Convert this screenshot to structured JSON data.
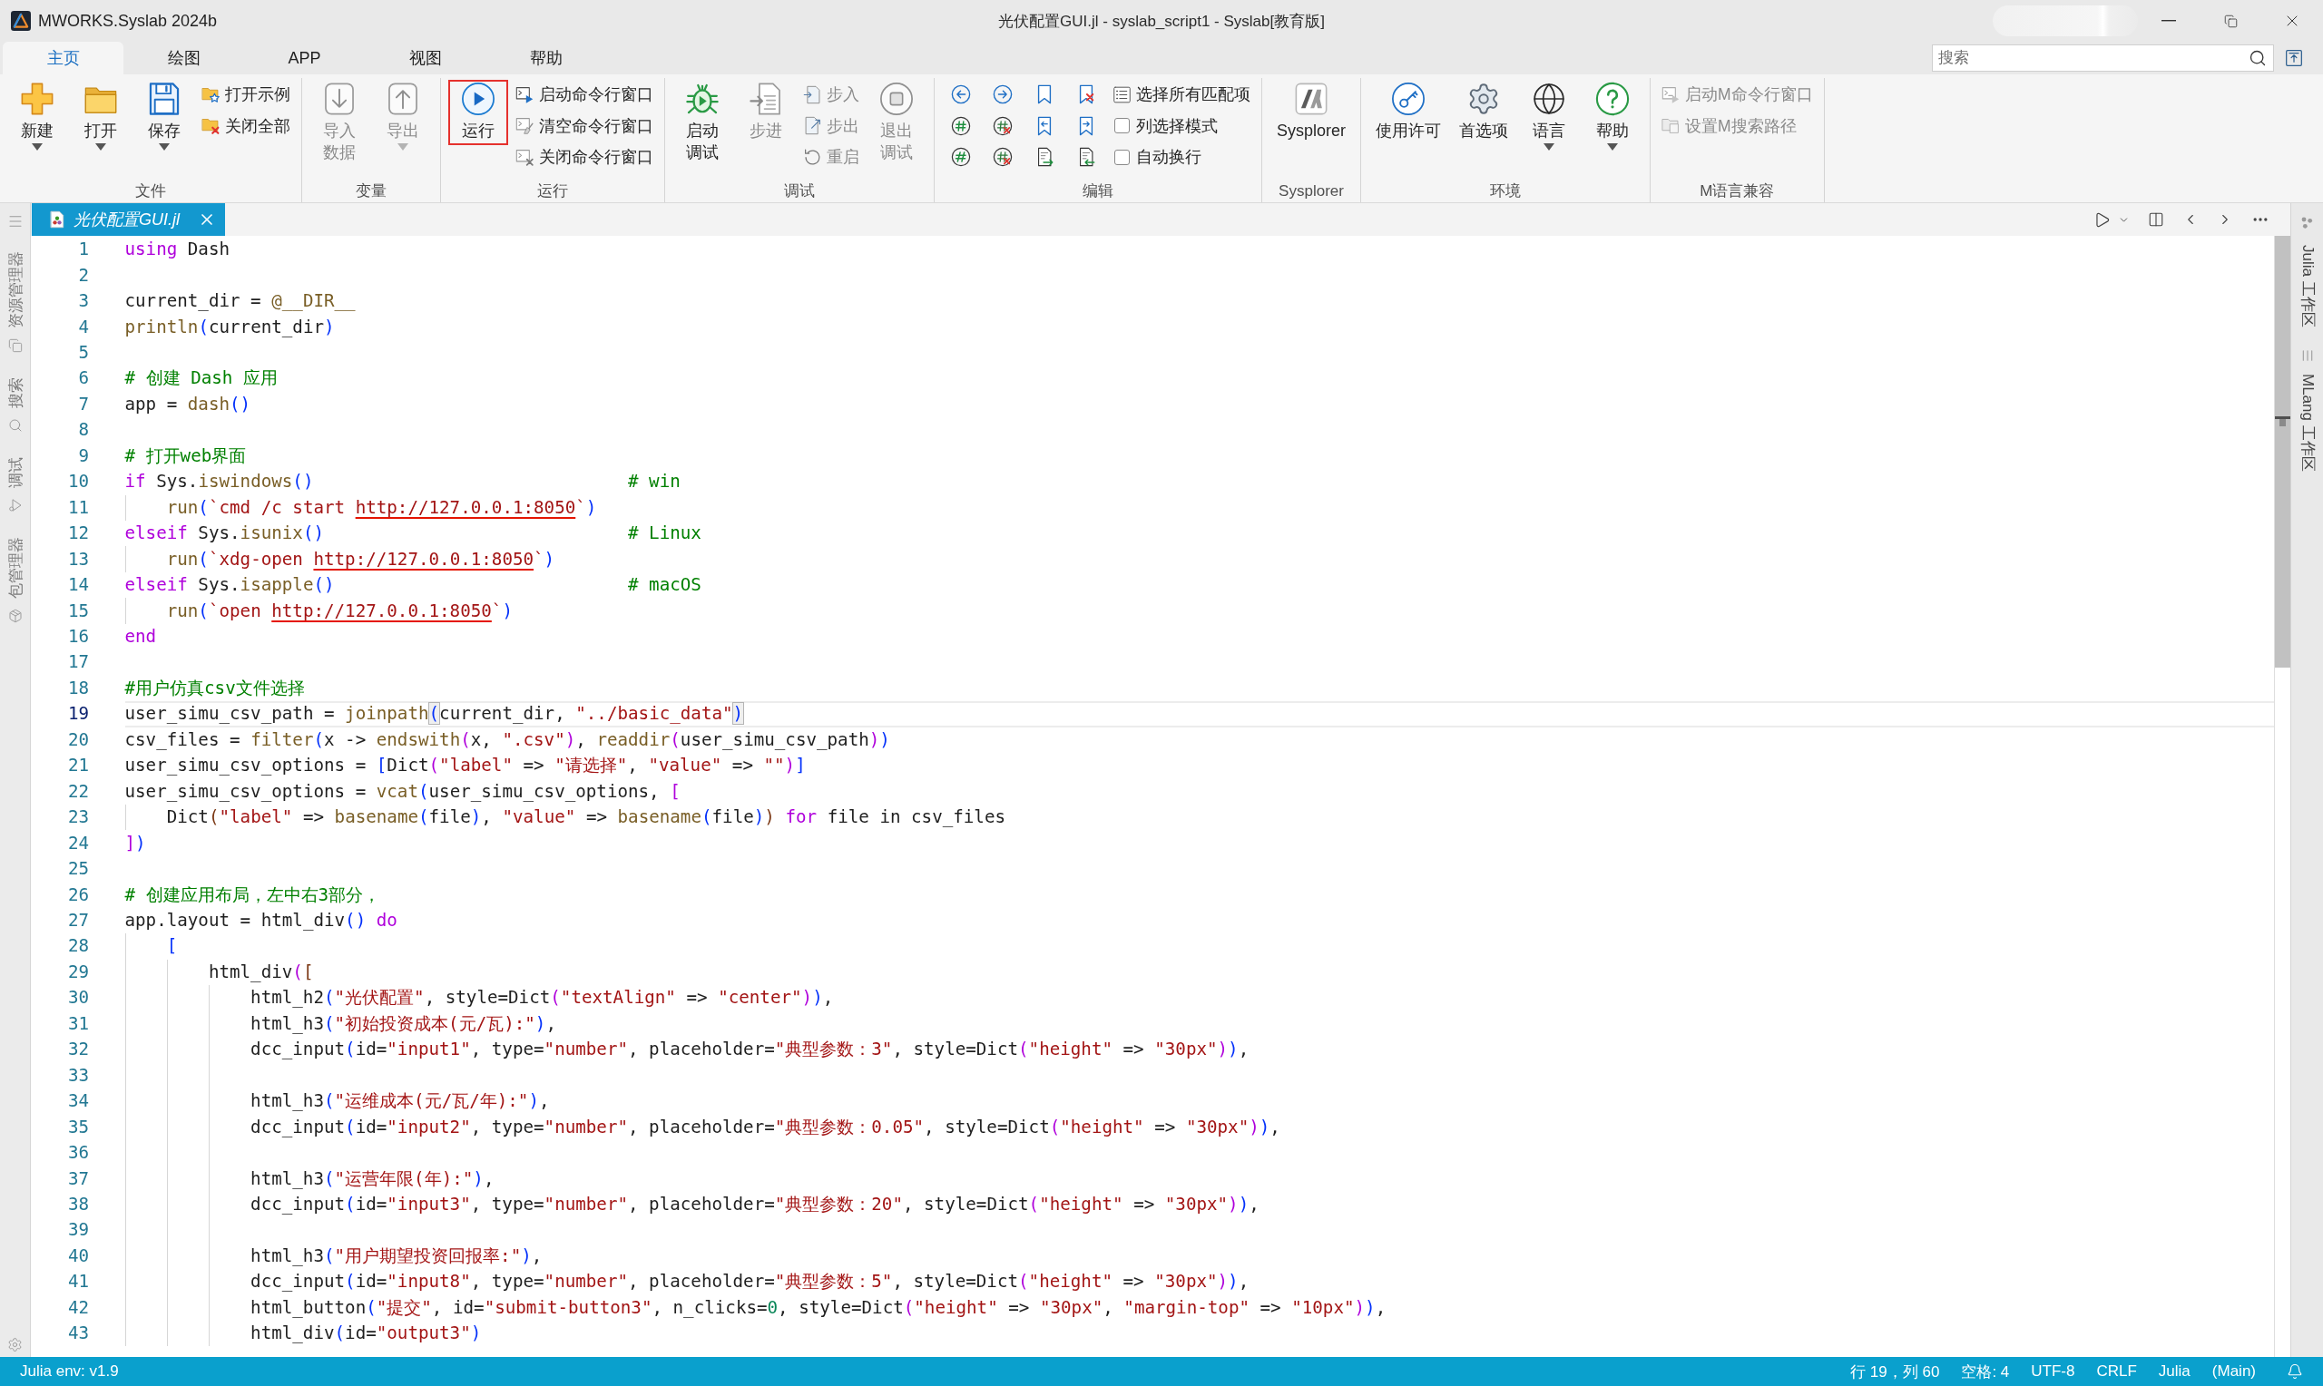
{
  "window": {
    "app_name": "MWORKS.Syslab 2024b",
    "title": "光伏配置GUI.jl - syslab_script1 - Syslab[教育版]"
  },
  "ribbon": {
    "tabs": [
      {
        "label": "主页",
        "selected": true
      },
      {
        "label": "绘图",
        "selected": false
      },
      {
        "label": "APP",
        "selected": false
      },
      {
        "label": "视图",
        "selected": false
      },
      {
        "label": "帮助",
        "selected": false
      }
    ],
    "search": {
      "placeholder": "搜索"
    },
    "groups": [
      {
        "label": "文件",
        "columns": [
          [
            {
              "kind": "large",
              "label_lines": [
                "新建"
              ],
              "dropdown": true,
              "disabled": false,
              "highlighted": false
            }
          ],
          [
            {
              "kind": "large",
              "label_lines": [
                "打开"
              ],
              "dropdown": true,
              "disabled": false,
              "highlighted": false
            }
          ],
          [
            {
              "kind": "large",
              "label_lines": [
                "保存"
              ],
              "dropdown": true,
              "disabled": false,
              "highlighted": false
            }
          ],
          [
            {
              "kind": "small",
              "label": "打开示例",
              "disabled": false
            },
            {
              "kind": "small",
              "label": "关闭全部",
              "disabled": false
            }
          ]
        ]
      },
      {
        "label": "变量",
        "columns": [
          [
            {
              "kind": "large",
              "label_lines": [
                "导入",
                "数据"
              ],
              "dropdown": false,
              "disabled": true,
              "highlighted": false
            }
          ],
          [
            {
              "kind": "large",
              "label_lines": [
                "导出"
              ],
              "dropdown": true,
              "disabled": true,
              "highlighted": false
            }
          ]
        ]
      },
      {
        "label": "运行",
        "columns": [
          [
            {
              "kind": "large",
              "label_lines": [
                "运行"
              ],
              "dropdown": false,
              "disabled": false,
              "highlighted": true
            }
          ],
          [
            {
              "kind": "small",
              "label": "启动命令行窗口",
              "disabled": false
            },
            {
              "kind": "small",
              "label": "清空命令行窗口",
              "disabled": false
            },
            {
              "kind": "small",
              "label": "关闭命令行窗口",
              "disabled": false
            }
          ]
        ]
      },
      {
        "label": "调试",
        "columns": [
          [
            {
              "kind": "large",
              "label_lines": [
                "启动",
                "调试"
              ],
              "dropdown": false,
              "disabled": false,
              "highlighted": false
            }
          ],
          [
            {
              "kind": "large",
              "label_lines": [
                "步进"
              ],
              "dropdown": false,
              "disabled": true,
              "highlighted": false
            }
          ],
          [
            {
              "kind": "small",
              "label": "步入",
              "disabled": true
            },
            {
              "kind": "small",
              "label": "步出",
              "disabled": true
            },
            {
              "kind": "small",
              "label": "重启",
              "disabled": true
            }
          ],
          [
            {
              "kind": "large",
              "label_lines": [
                "退出",
                "调试"
              ],
              "dropdown": false,
              "disabled": true,
              "highlighted": false
            }
          ]
        ]
      },
      {
        "label": "编辑",
        "columns": [
          [
            {
              "kind": "icon",
              "disabled": false
            },
            {
              "kind": "icon",
              "disabled": false
            },
            {
              "kind": "icon",
              "disabled": false
            }
          ],
          [
            {
              "kind": "icon",
              "disabled": false
            },
            {
              "kind": "icon",
              "disabled": false
            },
            {
              "kind": "icon",
              "disabled": false
            }
          ],
          [
            {
              "kind": "icon",
              "disabled": false
            },
            {
              "kind": "icon",
              "disabled": false
            },
            {
              "kind": "icon",
              "disabled": false
            }
          ],
          [
            {
              "kind": "icon",
              "disabled": false
            },
            {
              "kind": "icon",
              "disabled": false
            },
            {
              "kind": "icon",
              "disabled": false
            }
          ],
          [
            {
              "kind": "small",
              "label": "选择所有匹配项",
              "disabled": false
            },
            {
              "kind": "check",
              "label": "列选择模式",
              "checked": false
            },
            {
              "kind": "check",
              "label": "自动换行",
              "checked": false
            }
          ]
        ]
      },
      {
        "label": "Sysplorer",
        "columns": [
          [
            {
              "kind": "large",
              "label_lines": [
                "Sysplorer"
              ],
              "dropdown": false,
              "disabled": false,
              "highlighted": false
            }
          ]
        ]
      },
      {
        "label": "环境",
        "columns": [
          [
            {
              "kind": "large",
              "label_lines": [
                "使用许可"
              ],
              "dropdown": false,
              "disabled": false,
              "highlighted": false
            }
          ],
          [
            {
              "kind": "large",
              "label_lines": [
                "首选项"
              ],
              "dropdown": false,
              "disabled": false,
              "highlighted": false
            }
          ],
          [
            {
              "kind": "large",
              "label_lines": [
                "语言"
              ],
              "dropdown": true,
              "disabled": false,
              "highlighted": false
            }
          ],
          [
            {
              "kind": "large",
              "label_lines": [
                "帮助"
              ],
              "dropdown": true,
              "disabled": false,
              "highlighted": false
            }
          ]
        ]
      },
      {
        "label": "M语言兼容",
        "columns": [
          [
            {
              "kind": "small",
              "label": "启动M命令行窗口",
              "disabled": true
            },
            {
              "kind": "small",
              "label": "设置M搜索路径",
              "disabled": true
            }
          ]
        ]
      }
    ]
  },
  "activity_bar": [
    "资源管理器",
    "搜索",
    "调试",
    "包管理器"
  ],
  "editor": {
    "tabs": [
      {
        "label": "光伏配置GUI.jl",
        "selected": true
      }
    ],
    "lines": [
      {
        "number": "1",
        "current": false,
        "tokens": [
          {
            "text": "using",
            "kind": "keyword"
          },
          {
            "text": " Dash",
            "kind": "plain"
          }
        ]
      },
      {
        "number": "2",
        "current": false
      },
      {
        "number": "3",
        "current": false,
        "tokens": [
          {
            "text": "current_dir = ",
            "kind": "plain"
          },
          {
            "text": "@__DIR__",
            "kind": "macro"
          }
        ]
      },
      {
        "number": "4",
        "current": false,
        "tokens": [
          {
            "text": "println",
            "kind": "function"
          },
          {
            "text": "(",
            "kind": "bracket"
          },
          {
            "text": "current_dir",
            "kind": "plain"
          },
          {
            "text": ")",
            "kind": "bracket"
          }
        ]
      },
      {
        "number": "5",
        "current": false
      },
      {
        "number": "6",
        "current": false,
        "tokens": [
          {
            "text": "# 创建 Dash 应用",
            "kind": "comment"
          }
        ]
      },
      {
        "number": "7",
        "current": false,
        "tokens": [
          {
            "text": "app = ",
            "kind": "plain"
          },
          {
            "text": "dash",
            "kind": "function"
          },
          {
            "text": "()",
            "kind": "bracket"
          }
        ]
      },
      {
        "number": "8",
        "current": false
      },
      {
        "number": "9",
        "current": false,
        "tokens": [
          {
            "text": "# 打开web界面",
            "kind": "comment"
          }
        ]
      },
      {
        "number": "10",
        "current": false,
        "tokens": [
          {
            "text": "if",
            "kind": "keyword"
          },
          {
            "text": " Sys.",
            "kind": "plain"
          },
          {
            "text": "iswindows",
            "kind": "function"
          },
          {
            "text": "()",
            "kind": "bracket"
          },
          {
            "text": "                              # win",
            "kind": "comment"
          }
        ]
      },
      {
        "number": "11",
        "current": false,
        "tokens": [
          {
            "text": "    run",
            "kind": "function"
          },
          {
            "text": "(",
            "kind": "bracket"
          },
          {
            "text": "`cmd /c start ",
            "kind": "string"
          },
          {
            "text": "http://127.0.0.1:8050",
            "kind": "link"
          },
          {
            "text": "`",
            "kind": "string"
          },
          {
            "text": ")",
            "kind": "bracket"
          }
        ]
      },
      {
        "number": "12",
        "current": false,
        "tokens": [
          {
            "text": "elseif",
            "kind": "keyword"
          },
          {
            "text": " Sys.",
            "kind": "plain"
          },
          {
            "text": "isunix",
            "kind": "function"
          },
          {
            "text": "()",
            "kind": "bracket"
          },
          {
            "text": "                             # Linux",
            "kind": "comment"
          }
        ]
      },
      {
        "number": "13",
        "current": false,
        "tokens": [
          {
            "text": "    run",
            "kind": "function"
          },
          {
            "text": "(",
            "kind": "bracket"
          },
          {
            "text": "`xdg-open ",
            "kind": "string"
          },
          {
            "text": "http://127.0.0.1:8050",
            "kind": "link"
          },
          {
            "text": "`",
            "kind": "string"
          },
          {
            "text": ")",
            "kind": "bracket"
          }
        ]
      },
      {
        "number": "14",
        "current": false,
        "tokens": [
          {
            "text": "elseif",
            "kind": "keyword"
          },
          {
            "text": " Sys.",
            "kind": "plain"
          },
          {
            "text": "isapple",
            "kind": "function"
          },
          {
            "text": "()",
            "kind": "bracket"
          },
          {
            "text": "                            # macOS",
            "kind": "comment"
          }
        ]
      },
      {
        "number": "15",
        "current": false,
        "tokens": [
          {
            "text": "    run",
            "kind": "function"
          },
          {
            "text": "(",
            "kind": "bracket"
          },
          {
            "text": "`open ",
            "kind": "string"
          },
          {
            "text": "http://127.0.0.1:8050",
            "kind": "link"
          },
          {
            "text": "`",
            "kind": "string"
          },
          {
            "text": ")",
            "kind": "bracket"
          }
        ]
      },
      {
        "number": "16",
        "current": false,
        "tokens": [
          {
            "text": "end",
            "kind": "keyword"
          }
        ]
      },
      {
        "number": "17",
        "current": false
      },
      {
        "number": "18",
        "current": false,
        "tokens": [
          {
            "text": "#用户仿真csv文件选择",
            "kind": "comment"
          }
        ]
      },
      {
        "number": "19",
        "current": true,
        "tokens": [
          {
            "text": "user_simu_csv_path = ",
            "kind": "plain"
          },
          {
            "text": "joinpath",
            "kind": "function"
          },
          {
            "text": "(",
            "kind": "match"
          },
          {
            "text": "current_dir, ",
            "kind": "plain"
          },
          {
            "text": "\"../basic_data\"",
            "kind": "string"
          },
          {
            "text": ")",
            "kind": "match"
          }
        ]
      },
      {
        "number": "20",
        "current": false,
        "tokens": [
          {
            "text": "csv_files = ",
            "kind": "plain"
          },
          {
            "text": "filter",
            "kind": "function"
          },
          {
            "text": "(",
            "kind": "bracket"
          },
          {
            "text": "x -> ",
            "kind": "plain"
          },
          {
            "text": "endswith",
            "kind": "function"
          },
          {
            "text": "(",
            "kind": "bracket2"
          },
          {
            "text": "x, ",
            "kind": "plain"
          },
          {
            "text": "\".csv\"",
            "kind": "string"
          },
          {
            "text": ")",
            "kind": "bracket2"
          },
          {
            "text": ", ",
            "kind": "plain"
          },
          {
            "text": "readdir",
            "kind": "function"
          },
          {
            "text": "(",
            "kind": "bracket2"
          },
          {
            "text": "user_simu_csv_path",
            "kind": "plain"
          },
          {
            "text": ")",
            "kind": "bracket2"
          },
          {
            "text": ")",
            "kind": "bracket"
          }
        ]
      },
      {
        "number": "21",
        "current": false,
        "tokens": [
          {
            "text": "user_simu_csv_options = ",
            "kind": "plain"
          },
          {
            "text": "[",
            "kind": "bracket"
          },
          {
            "text": "Dict",
            "kind": "plain"
          },
          {
            "text": "(",
            "kind": "bracket2"
          },
          {
            "text": "\"label\"",
            "kind": "string"
          },
          {
            "text": " => ",
            "kind": "plain"
          },
          {
            "text": "\"请选择\"",
            "kind": "string"
          },
          {
            "text": ", ",
            "kind": "plain"
          },
          {
            "text": "\"value\"",
            "kind": "string"
          },
          {
            "text": " => ",
            "kind": "plain"
          },
          {
            "text": "\"\"",
            "kind": "string"
          },
          {
            "text": ")",
            "kind": "bracket2"
          },
          {
            "text": "]",
            "kind": "bracket"
          }
        ]
      },
      {
        "number": "22",
        "current": false,
        "tokens": [
          {
            "text": "user_simu_csv_options = ",
            "kind": "plain"
          },
          {
            "text": "vcat",
            "kind": "function"
          },
          {
            "text": "(",
            "kind": "bracket"
          },
          {
            "text": "user_simu_csv_options, ",
            "kind": "plain"
          },
          {
            "text": "[",
            "kind": "bracket2"
          }
        ]
      },
      {
        "number": "23",
        "current": false,
        "tokens": [
          {
            "text": "    Dict",
            "kind": "plain"
          },
          {
            "text": "(",
            "kind": "bracket3"
          },
          {
            "text": "\"label\"",
            "kind": "string"
          },
          {
            "text": " => ",
            "kind": "plain"
          },
          {
            "text": "basename",
            "kind": "function"
          },
          {
            "text": "(",
            "kind": "bracket"
          },
          {
            "text": "file",
            "kind": "plain"
          },
          {
            "text": ")",
            "kind": "bracket"
          },
          {
            "text": ", ",
            "kind": "plain"
          },
          {
            "text": "\"value\"",
            "kind": "string"
          },
          {
            "text": " => ",
            "kind": "plain"
          },
          {
            "text": "basename",
            "kind": "function"
          },
          {
            "text": "(",
            "kind": "bracket"
          },
          {
            "text": "file",
            "kind": "plain"
          },
          {
            "text": ")",
            "kind": "bracket"
          },
          {
            "text": ")",
            "kind": "bracket3"
          },
          {
            "text": " for",
            "kind": "keyword"
          },
          {
            "text": " file in csv_files",
            "kind": "plain"
          }
        ]
      },
      {
        "number": "24",
        "current": false,
        "tokens": [
          {
            "text": "]",
            "kind": "bracket2"
          },
          {
            "text": ")",
            "kind": "bracket"
          }
        ]
      },
      {
        "number": "25",
        "current": false
      },
      {
        "number": "26",
        "current": false,
        "tokens": [
          {
            "text": "# 创建应用布局，左中右3部分，",
            "kind": "comment"
          }
        ]
      },
      {
        "number": "27",
        "current": false,
        "tokens": [
          {
            "text": "app.layout = html_div",
            "kind": "plain"
          },
          {
            "text": "()",
            "kind": "bracket"
          },
          {
            "text": " do",
            "kind": "keyword"
          }
        ]
      },
      {
        "number": "28",
        "current": false,
        "tokens": [
          {
            "text": "    [",
            "kind": "bracket"
          }
        ]
      },
      {
        "number": "29",
        "current": false,
        "tokens": [
          {
            "text": "        html_div",
            "kind": "plain"
          },
          {
            "text": "(",
            "kind": "bracket2"
          },
          {
            "text": "[",
            "kind": "bracket3"
          }
        ]
      },
      {
        "number": "30",
        "current": false,
        "tokens": [
          {
            "text": "            html_h2",
            "kind": "plain"
          },
          {
            "text": "(",
            "kind": "bracket"
          },
          {
            "text": "\"光伏配置\"",
            "kind": "string"
          },
          {
            "text": ", style=Dict",
            "kind": "plain"
          },
          {
            "text": "(",
            "kind": "bracket2"
          },
          {
            "text": "\"textAlign\"",
            "kind": "string"
          },
          {
            "text": " => ",
            "kind": "plain"
          },
          {
            "text": "\"center\"",
            "kind": "string"
          },
          {
            "text": ")",
            "kind": "bracket2"
          },
          {
            "text": ")",
            "kind": "bracket"
          },
          {
            "text": ",",
            "kind": "plain"
          }
        ]
      },
      {
        "number": "31",
        "current": false,
        "tokens": [
          {
            "text": "            html_h3",
            "kind": "plain"
          },
          {
            "text": "(",
            "kind": "bracket"
          },
          {
            "text": "\"初始投资成本(元/瓦):\"",
            "kind": "string"
          },
          {
            "text": ")",
            "kind": "bracket"
          },
          {
            "text": ",",
            "kind": "plain"
          }
        ]
      },
      {
        "number": "32",
        "current": false,
        "tokens": [
          {
            "text": "            dcc_input",
            "kind": "plain"
          },
          {
            "text": "(",
            "kind": "bracket"
          },
          {
            "text": "id=",
            "kind": "plain"
          },
          {
            "text": "\"input1\"",
            "kind": "string"
          },
          {
            "text": ", type=",
            "kind": "plain"
          },
          {
            "text": "\"number\"",
            "kind": "string"
          },
          {
            "text": ", placeholder=",
            "kind": "plain"
          },
          {
            "text": "\"典型参数：3\"",
            "kind": "string"
          },
          {
            "text": ", style=Dict",
            "kind": "plain"
          },
          {
            "text": "(",
            "kind": "bracket2"
          },
          {
            "text": "\"height\"",
            "kind": "string"
          },
          {
            "text": " => ",
            "kind": "plain"
          },
          {
            "text": "\"30px\"",
            "kind": "string"
          },
          {
            "text": ")",
            "kind": "bracket2"
          },
          {
            "text": ")",
            "kind": "bracket"
          },
          {
            "text": ",",
            "kind": "plain"
          }
        ]
      },
      {
        "number": "33",
        "current": false
      },
      {
        "number": "34",
        "current": false,
        "tokens": [
          {
            "text": "            html_h3",
            "kind": "plain"
          },
          {
            "text": "(",
            "kind": "bracket"
          },
          {
            "text": "\"运维成本(元/瓦/年):\"",
            "kind": "string"
          },
          {
            "text": ")",
            "kind": "bracket"
          },
          {
            "text": ",",
            "kind": "plain"
          }
        ]
      },
      {
        "number": "35",
        "current": false,
        "tokens": [
          {
            "text": "            dcc_input",
            "kind": "plain"
          },
          {
            "text": "(",
            "kind": "bracket"
          },
          {
            "text": "id=",
            "kind": "plain"
          },
          {
            "text": "\"input2\"",
            "kind": "string"
          },
          {
            "text": ", type=",
            "kind": "plain"
          },
          {
            "text": "\"number\"",
            "kind": "string"
          },
          {
            "text": ", placeholder=",
            "kind": "plain"
          },
          {
            "text": "\"典型参数：0.05\"",
            "kind": "string"
          },
          {
            "text": ", style=Dict",
            "kind": "plain"
          },
          {
            "text": "(",
            "kind": "bracket2"
          },
          {
            "text": "\"height\"",
            "kind": "string"
          },
          {
            "text": " => ",
            "kind": "plain"
          },
          {
            "text": "\"30px\"",
            "kind": "string"
          },
          {
            "text": ")",
            "kind": "bracket2"
          },
          {
            "text": ")",
            "kind": "bracket"
          },
          {
            "text": ",",
            "kind": "plain"
          }
        ]
      },
      {
        "number": "36",
        "current": false
      },
      {
        "number": "37",
        "current": false,
        "tokens": [
          {
            "text": "            html_h3",
            "kind": "plain"
          },
          {
            "text": "(",
            "kind": "bracket"
          },
          {
            "text": "\"运营年限(年):\"",
            "kind": "string"
          },
          {
            "text": ")",
            "kind": "bracket"
          },
          {
            "text": ",",
            "kind": "plain"
          }
        ]
      },
      {
        "number": "38",
        "current": false,
        "tokens": [
          {
            "text": "            dcc_input",
            "kind": "plain"
          },
          {
            "text": "(",
            "kind": "bracket"
          },
          {
            "text": "id=",
            "kind": "plain"
          },
          {
            "text": "\"input3\"",
            "kind": "string"
          },
          {
            "text": ", type=",
            "kind": "plain"
          },
          {
            "text": "\"number\"",
            "kind": "string"
          },
          {
            "text": ", placeholder=",
            "kind": "plain"
          },
          {
            "text": "\"典型参数：20\"",
            "kind": "string"
          },
          {
            "text": ", style=Dict",
            "kind": "plain"
          },
          {
            "text": "(",
            "kind": "bracket2"
          },
          {
            "text": "\"height\"",
            "kind": "string"
          },
          {
            "text": " => ",
            "kind": "plain"
          },
          {
            "text": "\"30px\"",
            "kind": "string"
          },
          {
            "text": ")",
            "kind": "bracket2"
          },
          {
            "text": ")",
            "kind": "bracket"
          },
          {
            "text": ",",
            "kind": "plain"
          }
        ]
      },
      {
        "number": "39",
        "current": false
      },
      {
        "number": "40",
        "current": false,
        "tokens": [
          {
            "text": "            html_h3",
            "kind": "plain"
          },
          {
            "text": "(",
            "kind": "bracket"
          },
          {
            "text": "\"用户期望投资回报率:\"",
            "kind": "string"
          },
          {
            "text": ")",
            "kind": "bracket"
          },
          {
            "text": ",",
            "kind": "plain"
          }
        ]
      },
      {
        "number": "41",
        "current": false,
        "tokens": [
          {
            "text": "            dcc_input",
            "kind": "plain"
          },
          {
            "text": "(",
            "kind": "bracket"
          },
          {
            "text": "id=",
            "kind": "plain"
          },
          {
            "text": "\"input8\"",
            "kind": "string"
          },
          {
            "text": ", type=",
            "kind": "plain"
          },
          {
            "text": "\"number\"",
            "kind": "string"
          },
          {
            "text": ", placeholder=",
            "kind": "plain"
          },
          {
            "text": "\"典型参数：5\"",
            "kind": "string"
          },
          {
            "text": ", style=Dict",
            "kind": "plain"
          },
          {
            "text": "(",
            "kind": "bracket2"
          },
          {
            "text": "\"height\"",
            "kind": "string"
          },
          {
            "text": " => ",
            "kind": "plain"
          },
          {
            "text": "\"30px\"",
            "kind": "string"
          },
          {
            "text": ")",
            "kind": "bracket2"
          },
          {
            "text": ")",
            "kind": "bracket"
          },
          {
            "text": ",",
            "kind": "plain"
          }
        ]
      },
      {
        "number": "42",
        "current": false,
        "tokens": [
          {
            "text": "            html_button",
            "kind": "plain"
          },
          {
            "text": "(",
            "kind": "bracket"
          },
          {
            "text": "\"提交\"",
            "kind": "string"
          },
          {
            "text": ", id=",
            "kind": "plain"
          },
          {
            "text": "\"submit-button3\"",
            "kind": "string"
          },
          {
            "text": ", n_clicks=",
            "kind": "plain"
          },
          {
            "text": "0",
            "kind": "number"
          },
          {
            "text": ", style=Dict",
            "kind": "plain"
          },
          {
            "text": "(",
            "kind": "bracket2"
          },
          {
            "text": "\"height\"",
            "kind": "string"
          },
          {
            "text": " => ",
            "kind": "plain"
          },
          {
            "text": "\"30px\"",
            "kind": "string"
          },
          {
            "text": ", ",
            "kind": "plain"
          },
          {
            "text": "\"margin-top\"",
            "kind": "string"
          },
          {
            "text": " => ",
            "kind": "plain"
          },
          {
            "text": "\"10px\"",
            "kind": "string"
          },
          {
            "text": ")",
            "kind": "bracket2"
          },
          {
            "text": ")",
            "kind": "bracket"
          },
          {
            "text": ",",
            "kind": "plain"
          }
        ]
      },
      {
        "number": "43",
        "current": false,
        "tokens": [
          {
            "text": "            html_div",
            "kind": "plain"
          },
          {
            "text": "(",
            "kind": "bracket"
          },
          {
            "text": "id=",
            "kind": "plain"
          },
          {
            "text": "\"output3\"",
            "kind": "string"
          },
          {
            "text": ")",
            "kind": "bracket"
          }
        ]
      }
    ]
  },
  "side_panel": [
    "Julia 工作区",
    "MLang 工作区"
  ],
  "status_bar": {
    "left": "Julia env: v1.9",
    "items": [
      "行 19，列 60",
      "空格: 4",
      "UTF-8",
      "CRLF",
      "Julia",
      "(Main)"
    ]
  }
}
